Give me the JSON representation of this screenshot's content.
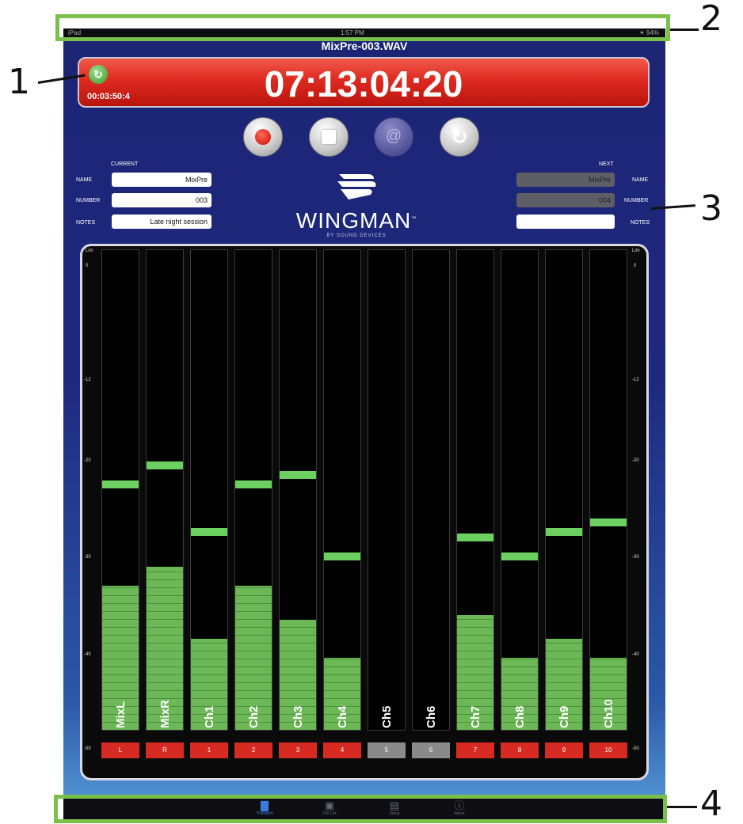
{
  "status_bar": {
    "left": "iPad",
    "time": "1:57 PM",
    "right": "✶ 94%"
  },
  "file_name": "MixPre-003.WAV",
  "timecode": {
    "value": "07:13:04:20",
    "elapsed": "00:03:50:4"
  },
  "transport": {
    "record_icon": "record-icon",
    "stop_icon": "stop-icon",
    "at_icon": "at-icon",
    "reset_icon": "reset-icon"
  },
  "metadata": {
    "current": {
      "heading": "CURRENT",
      "name_label": "NAME",
      "number_label": "NUMBER",
      "notes_label": "NOTES",
      "name": "MixPre",
      "number": "003",
      "notes": "Late night session"
    },
    "next": {
      "heading": "NEXT",
      "name_label": "NAME",
      "number_label": "NUMBER",
      "notes_label": "NOTES",
      "name": "MixPre",
      "number": "004",
      "notes": ""
    }
  },
  "logo": {
    "word": "WINGMAN",
    "tm": "™",
    "sub": "BY SOUND DEVICES"
  },
  "meter_scale": [
    "Lim",
    "0",
    "-12",
    "-20",
    "-30",
    "-40",
    "-50"
  ],
  "meters": [
    {
      "name": "MixL",
      "tag": "L",
      "fill": 0.3,
      "peak": 0.52,
      "active": true
    },
    {
      "name": "MixR",
      "tag": "R",
      "fill": 0.34,
      "peak": 0.56,
      "active": true
    },
    {
      "name": "Ch1",
      "tag": "1",
      "fill": 0.19,
      "peak": 0.42,
      "active": true
    },
    {
      "name": "Ch2",
      "tag": "2",
      "fill": 0.3,
      "peak": 0.52,
      "active": true
    },
    {
      "name": "Ch3",
      "tag": "3",
      "fill": 0.23,
      "peak": 0.54,
      "active": true
    },
    {
      "name": "Ch4",
      "tag": "4",
      "fill": 0.15,
      "peak": 0.37,
      "active": true
    },
    {
      "name": "Ch5",
      "tag": "5",
      "fill": 0,
      "peak": null,
      "active": false
    },
    {
      "name": "Ch6",
      "tag": "6",
      "fill": 0,
      "peak": null,
      "active": false
    },
    {
      "name": "Ch7",
      "tag": "7",
      "fill": 0.24,
      "peak": 0.41,
      "active": true
    },
    {
      "name": "Ch8",
      "tag": "8",
      "fill": 0.15,
      "peak": 0.37,
      "active": true
    },
    {
      "name": "Ch9",
      "tag": "9",
      "fill": 0.19,
      "peak": 0.42,
      "active": true
    },
    {
      "name": "Ch10",
      "tag": "10",
      "fill": 0.15,
      "peak": 0.44,
      "active": true
    }
  ],
  "tabs": [
    {
      "label": "Transport",
      "icon": "meters-icon",
      "active": true
    },
    {
      "label": "File List",
      "icon": "folder-icon",
      "active": false
    },
    {
      "label": "Setup",
      "icon": "setup-icon",
      "active": false
    },
    {
      "label": "About",
      "icon": "info-icon",
      "active": false
    }
  ],
  "callouts": [
    "1",
    "2",
    "3",
    "4"
  ],
  "colors": {
    "meter_green": "#6cb857",
    "peak_green": "#6cd060",
    "tag_red": "#d62a22",
    "tag_gray": "#8a8a8a",
    "annotation_green": "#79c14a",
    "tab_active": "#3a7ad8"
  }
}
